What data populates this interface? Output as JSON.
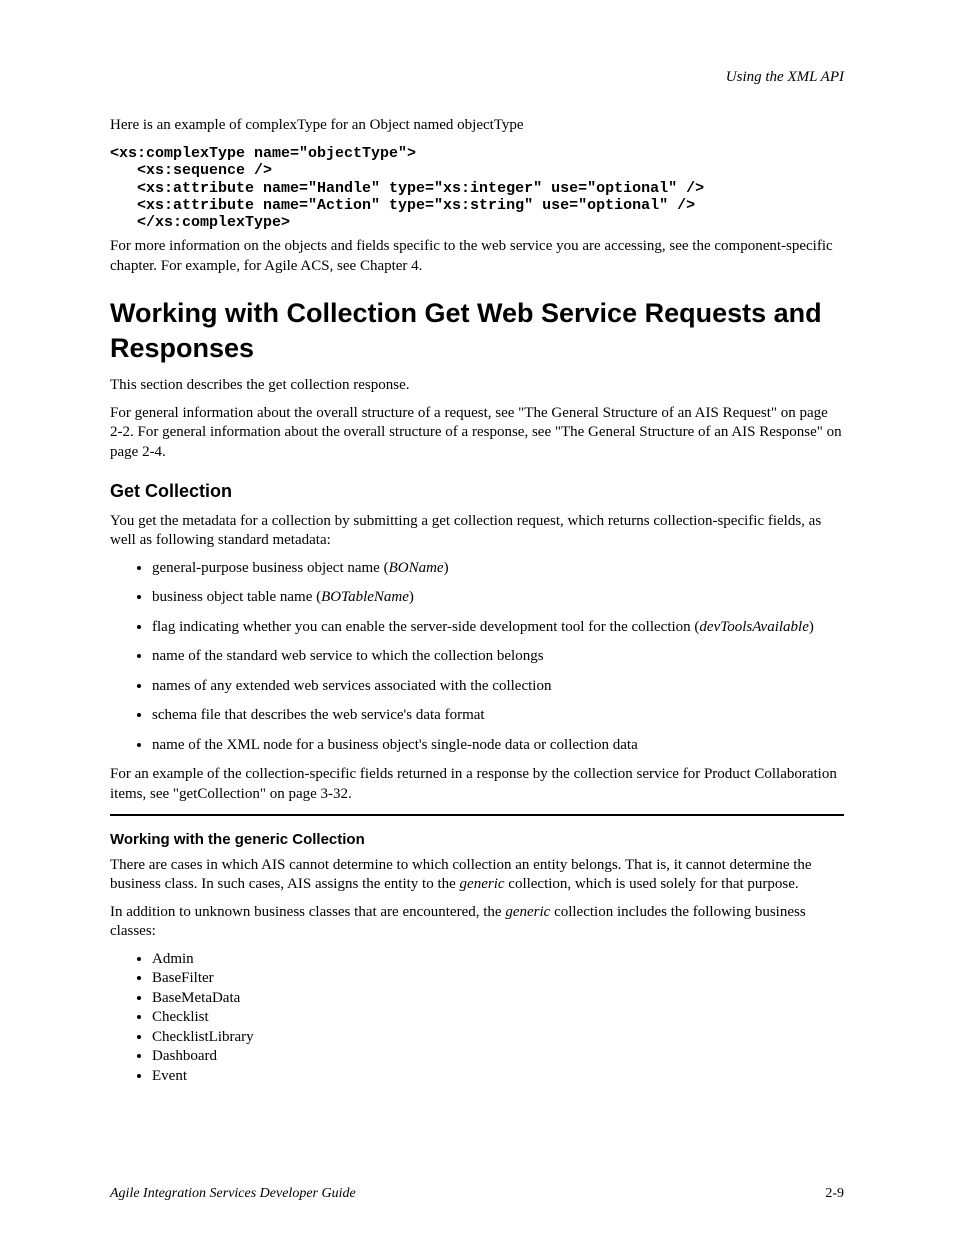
{
  "header_right": "Using the XML API",
  "intro": "Here is an example of complexType for an Object named objectType",
  "code": "<xs:complexType name=\"objectType\">\n   <xs:sequence />\n   <xs:attribute name=\"Handle\" type=\"xs:integer\" use=\"optional\" />\n   <xs:attribute name=\"Action\" type=\"xs:string\" use=\"optional\" />\n   </xs:complexType>",
  "after_code": "For more information on the objects and fields specific to the web service you are accessing, see the component-specific chapter. For example, for Agile ACS, see Chapter 4.",
  "h_main": "Working with Collection Get Web Service Requests and Responses",
  "p_main1": "This section describes the get collection response.",
  "p_main2": "For general information about the overall structure of a request, see \"The General Structure of an AIS Request\" on page 2-2. For general information about the overall structure of a response, see \"The General Structure of an AIS Response\" on page 2-4.",
  "h_sub1": "Get Collection",
  "p_sub1": "You get the metadata for a collection by submitting a get collection request, which returns collection-specific fields, as well as following standard metadata:",
  "bullets1": {
    "b0": {
      "pre": "general-purpose business object name (",
      "code": "BOName",
      "post": ")"
    },
    "b1": {
      "pre": "business object table name (",
      "code": "BOTableName",
      "post": ")"
    },
    "b2": {
      "pre": "flag indicating whether you can enable the server-side development tool for the collection (",
      "code": "devToolsAvailable",
      "post": ")"
    },
    "b3": {
      "text": "name of the standard web service to which the collection belongs"
    },
    "b4": {
      "text": "names of any extended web services associated with the collection"
    },
    "b5": {
      "text": "schema file that describes the web service's data format"
    },
    "b6": {
      "text": "name of the XML node for a business object's single-node data or collection data"
    }
  },
  "p_after_bullets1": "For an example of the collection-specific fields returned in a response by the collection service for Product Collaboration items, see \"getCollection\" on page 3-32.",
  "h_sub2": "Working with the generic Collection",
  "p_sub2_1": "There are cases in which AIS cannot determine to which collection an entity belongs. That is, it cannot determine the business class. In such cases, AIS assigns the entity to the",
  "p_sub2_2_code": "generic",
  "p_sub2_2_rest": " collection, which is used solely for that purpose.",
  "p_sub2_3_pre": "In addition to unknown business classes that are encountered, the ",
  "p_sub2_3_code": "generic",
  "p_sub2_3_post": " collection includes the following business classes:",
  "bullets2": {
    "b0": "Admin",
    "b1": "BaseFilter",
    "b2": "BaseMetaData",
    "b3": "Checklist",
    "b4": "ChecklistLibrary",
    "b5": "Dashboard",
    "b6": "Event"
  },
  "footer_left": "Agile Integration Services Developer Guide",
  "footer_right": "2-9"
}
